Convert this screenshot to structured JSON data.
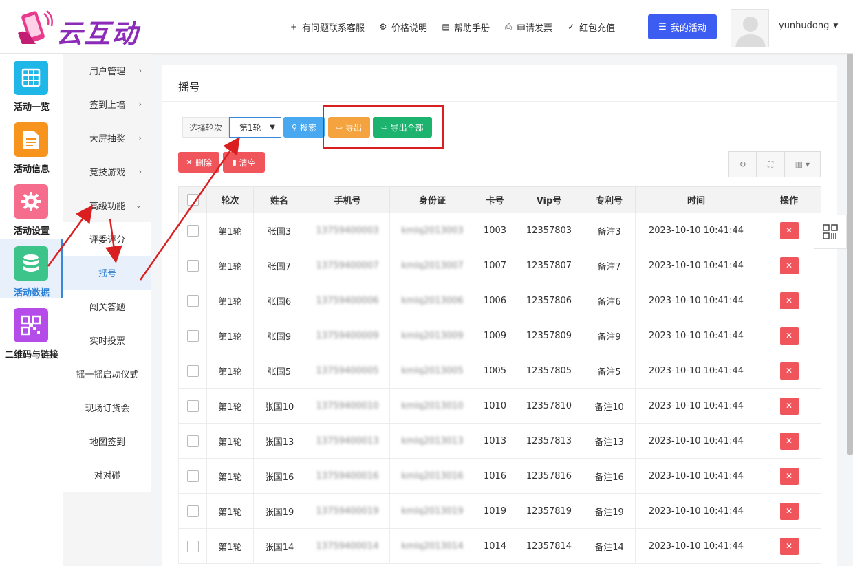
{
  "brand": {
    "logo_text": "云互动"
  },
  "header": {
    "links": [
      {
        "icon": "person-add-icon",
        "glyph": "+",
        "label": "有问题联系客服"
      },
      {
        "icon": "gear-icon",
        "glyph": "⚙",
        "label": "价格说明"
      },
      {
        "icon": "book-icon",
        "glyph": "▤",
        "label": "帮助手册"
      },
      {
        "icon": "printer-icon",
        "glyph": "⎙",
        "label": "申请发票"
      },
      {
        "icon": "shield-check-icon",
        "glyph": "✓",
        "label": "红包充值"
      }
    ],
    "my_activity": "我的活动",
    "username": "yunhudong"
  },
  "iconbar": [
    {
      "label": "活动一览",
      "icon": "grid-icon",
      "color": "#1fb6e8"
    },
    {
      "label": "活动信息",
      "icon": "document-icon",
      "color": "#f7941d"
    },
    {
      "label": "活动设置",
      "icon": "gear-icon",
      "color": "#f56c8d"
    },
    {
      "label": "活动数据",
      "icon": "database-icon",
      "color": "#3cc48a"
    },
    {
      "label": "二维码与链接",
      "icon": "qrcode-icon",
      "color": "#b54be8"
    }
  ],
  "submenu": {
    "items": [
      "用户管理",
      "签到上墙",
      "大屏抽奖",
      "竞技游戏",
      "高级功能"
    ],
    "sub_items": [
      "评委评分",
      "摇号",
      "闯关答题",
      "实时投票",
      "摇一摇启动仪式",
      "现场订货会",
      "地图签到",
      "对对碰"
    ]
  },
  "panel": {
    "title": "摇号"
  },
  "filter": {
    "round_label": "选择轮次",
    "round_value": "第1轮",
    "search": "搜索",
    "export": "导出",
    "export_all": "导出全部",
    "delete": "删除",
    "clear": "清空"
  },
  "table": {
    "headers": [
      "轮次",
      "姓名",
      "手机号",
      "身份证",
      "卡号",
      "Vip号",
      "专利号",
      "时间",
      "操作"
    ],
    "rows": [
      {
        "round": "第1轮",
        "name": "张国3",
        "phone": "13759400003",
        "id": "kmlq2013003",
        "card": "1003",
        "vip": "12357803",
        "patent": "备注3",
        "time": "2023-10-10 10:41:44"
      },
      {
        "round": "第1轮",
        "name": "张国7",
        "phone": "13759400007",
        "id": "kmlq2013007",
        "card": "1007",
        "vip": "12357807",
        "patent": "备注7",
        "time": "2023-10-10 10:41:44"
      },
      {
        "round": "第1轮",
        "name": "张国6",
        "phone": "13759400006",
        "id": "kmlq2013006",
        "card": "1006",
        "vip": "12357806",
        "patent": "备注6",
        "time": "2023-10-10 10:41:44"
      },
      {
        "round": "第1轮",
        "name": "张国9",
        "phone": "13759400009",
        "id": "kmlq2013009",
        "card": "1009",
        "vip": "12357809",
        "patent": "备注9",
        "time": "2023-10-10 10:41:44"
      },
      {
        "round": "第1轮",
        "name": "张国5",
        "phone": "13759400005",
        "id": "kmlq2013005",
        "card": "1005",
        "vip": "12357805",
        "patent": "备注5",
        "time": "2023-10-10 10:41:44"
      },
      {
        "round": "第1轮",
        "name": "张国10",
        "phone": "13759400010",
        "id": "kmlq2013010",
        "card": "1010",
        "vip": "12357810",
        "patent": "备注10",
        "time": "2023-10-10 10:41:44"
      },
      {
        "round": "第1轮",
        "name": "张国13",
        "phone": "13759400013",
        "id": "kmlq2013013",
        "card": "1013",
        "vip": "12357813",
        "patent": "备注13",
        "time": "2023-10-10 10:41:44"
      },
      {
        "round": "第1轮",
        "name": "张国16",
        "phone": "13759400016",
        "id": "kmlq2013016",
        "card": "1016",
        "vip": "12357816",
        "patent": "备注16",
        "time": "2023-10-10 10:41:44"
      },
      {
        "round": "第1轮",
        "name": "张国19",
        "phone": "13759400019",
        "id": "kmlq2013019",
        "card": "1019",
        "vip": "12357819",
        "patent": "备注19",
        "time": "2023-10-10 10:41:44"
      },
      {
        "round": "第1轮",
        "name": "张国14",
        "phone": "13759400014",
        "id": "kmlq2013014",
        "card": "1014",
        "vip": "12357814",
        "patent": "备注14",
        "time": "2023-10-10 10:41:44"
      }
    ]
  },
  "colors": {
    "accent": "#3c5cf2",
    "active": "#2c7fd6",
    "annotation": "#d91f1f"
  }
}
